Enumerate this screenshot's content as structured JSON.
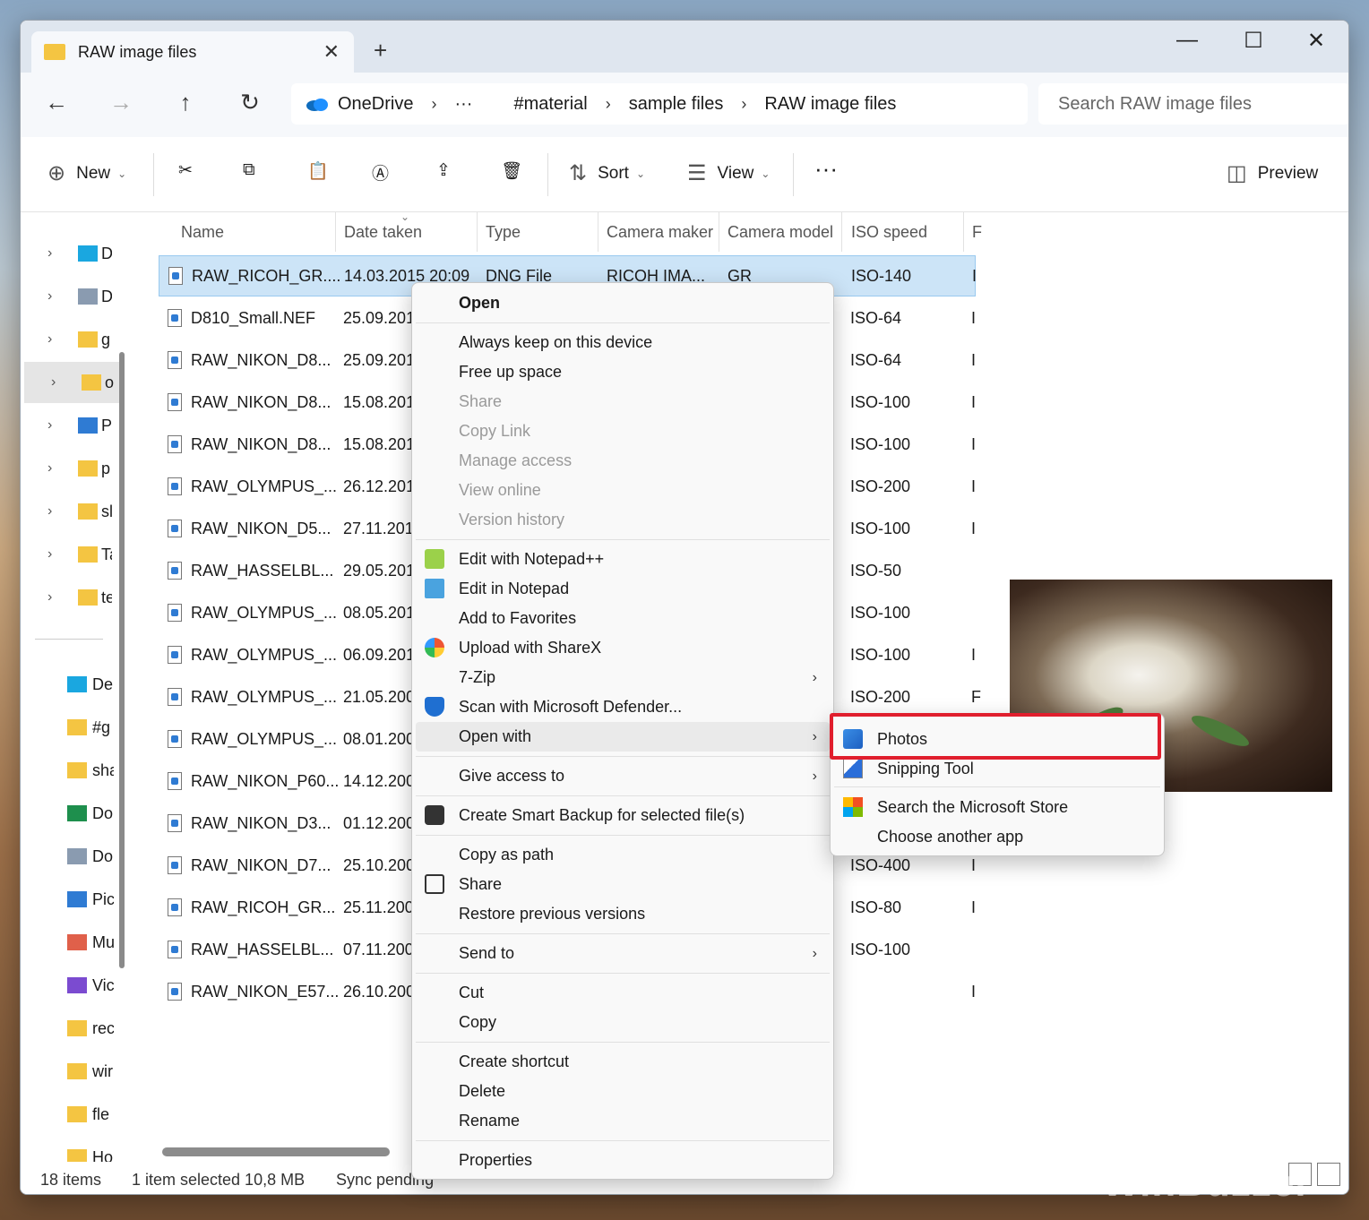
{
  "window": {
    "tab_title": "RAW image files"
  },
  "address": {
    "crumbs": [
      "OneDrive",
      "···",
      "#material",
      "sample files",
      "RAW image files"
    ],
    "search_placeholder": "Search RAW image files"
  },
  "toolbar": {
    "new_label": "New",
    "sort_label": "Sort",
    "view_label": "View",
    "preview_label": "Preview"
  },
  "nav": {
    "top": [
      {
        "l": "D",
        "icon": "desktop-icon"
      },
      {
        "l": "D",
        "icon": "document-icon"
      },
      {
        "l": "g",
        "icon": "folder-icon"
      },
      {
        "l": "o",
        "icon": "folder-icon"
      },
      {
        "l": "P",
        "icon": "pictures-icon"
      },
      {
        "l": "p",
        "icon": "folder-icon"
      },
      {
        "l": "sl",
        "icon": "folder-icon"
      },
      {
        "l": "Ta",
        "icon": "folder-icon"
      },
      {
        "l": "te",
        "icon": "folder-icon"
      }
    ],
    "bottom": [
      {
        "l": "De",
        "icon": "desktop-icon"
      },
      {
        "l": "#g",
        "icon": "folder-icon"
      },
      {
        "l": "sha",
        "icon": "folder-icon"
      },
      {
        "l": "Do",
        "icon": "download-icon"
      },
      {
        "l": "Do",
        "icon": "document-icon"
      },
      {
        "l": "Pic",
        "icon": "pictures-icon"
      },
      {
        "l": "Mu",
        "icon": "music-icon"
      },
      {
        "l": "Vic",
        "icon": "video-icon"
      },
      {
        "l": "rec",
        "icon": "folder-icon"
      },
      {
        "l": "wir",
        "icon": "folder-icon"
      },
      {
        "l": "fle",
        "icon": "folder-icon"
      },
      {
        "l": "Ho",
        "icon": "folder-icon"
      }
    ]
  },
  "columns": [
    "Name",
    "Date taken",
    "Type",
    "Camera maker",
    "Camera model",
    "ISO speed",
    "F"
  ],
  "files": [
    {
      "name": "RAW_RICOH_GR....",
      "date": "14.03.2015 20:09",
      "type": "DNG File",
      "maker": "RICOH IMA...",
      "model": "GR",
      "iso": "ISO-140",
      "f": "I"
    },
    {
      "name": "D810_Small.NEF",
      "date": "25.09.201",
      "iso": "ISO-64",
      "f": "I"
    },
    {
      "name": "RAW_NIKON_D8...",
      "date": "25.09.201",
      "iso": "ISO-64",
      "f": "I"
    },
    {
      "name": "RAW_NIKON_D8...",
      "date": "15.08.201",
      "iso": "ISO-100",
      "f": "I"
    },
    {
      "name": "RAW_NIKON_D8...",
      "date": "15.08.201",
      "iso": "ISO-100",
      "f": "I"
    },
    {
      "name": "RAW_OLYMPUS_...",
      "date": "26.12.201",
      "iso": "ISO-200",
      "f": "I"
    },
    {
      "name": "RAW_NIKON_D5...",
      "date": "27.11.201",
      "iso": "ISO-100",
      "f": "I"
    },
    {
      "name": "RAW_HASSELBL...",
      "date": "29.05.201",
      "iso": "ISO-50",
      "f": ""
    },
    {
      "name": "RAW_OLYMPUS_...",
      "date": "08.05.201",
      "iso": "ISO-100",
      "f": ""
    },
    {
      "name": "RAW_OLYMPUS_...",
      "date": "06.09.201",
      "iso": "ISO-100",
      "f": "I"
    },
    {
      "name": "RAW_OLYMPUS_...",
      "date": "21.05.200",
      "iso": "ISO-200",
      "f": "F"
    },
    {
      "name": "RAW_OLYMPUS_...",
      "date": "08.01.200",
      "iso": "",
      "f": ""
    },
    {
      "name": "RAW_NIKON_P60...",
      "date": "14.12.200",
      "iso": "",
      "f": ""
    },
    {
      "name": "RAW_NIKON_D3...",
      "date": "01.12.200",
      "iso": "",
      "f": ""
    },
    {
      "name": "RAW_NIKON_D7...",
      "date": "25.10.200",
      "iso": "ISO-400",
      "f": "I"
    },
    {
      "name": "RAW_RICOH_GR...",
      "date": "25.11.200",
      "iso": "ISO-80",
      "f": "I"
    },
    {
      "name": "RAW_HASSELBL...",
      "date": "07.11.200",
      "iso": "ISO-100",
      "f": ""
    },
    {
      "name": "RAW_NIKON_E57...",
      "date": "26.10.200",
      "iso": "",
      "f": "I"
    }
  ],
  "context_menu": [
    {
      "label": "Open",
      "bold": true
    },
    {
      "sep": true
    },
    {
      "label": "Always keep on this device"
    },
    {
      "label": "Free up space"
    },
    {
      "label": "Share",
      "disabled": true
    },
    {
      "label": "Copy Link",
      "disabled": true
    },
    {
      "label": "Manage access",
      "disabled": true
    },
    {
      "label": "View online",
      "disabled": true
    },
    {
      "label": "Version history",
      "disabled": true
    },
    {
      "sep": true
    },
    {
      "label": "Edit with Notepad++",
      "icon": "notepadpp-icon"
    },
    {
      "label": "Edit in Notepad",
      "icon": "notepad-icon"
    },
    {
      "label": "Add to Favorites"
    },
    {
      "label": "Upload with ShareX",
      "icon": "sharex-icon"
    },
    {
      "label": "7-Zip",
      "arrow": true
    },
    {
      "label": "Scan with Microsoft Defender...",
      "icon": "defender-icon"
    },
    {
      "label": "Open with",
      "arrow": true,
      "hover": true
    },
    {
      "sep": true
    },
    {
      "label": "Give access to",
      "arrow": true
    },
    {
      "sep": true
    },
    {
      "label": "Create Smart Backup for selected file(s)",
      "icon": "backup-icon"
    },
    {
      "sep": true
    },
    {
      "label": "Copy as path"
    },
    {
      "label": "Share",
      "icon": "share-icon"
    },
    {
      "label": "Restore previous versions"
    },
    {
      "sep": true
    },
    {
      "label": "Send to",
      "arrow": true
    },
    {
      "sep": true
    },
    {
      "label": "Cut"
    },
    {
      "label": "Copy"
    },
    {
      "sep": true
    },
    {
      "label": "Create shortcut"
    },
    {
      "label": "Delete"
    },
    {
      "label": "Rename"
    },
    {
      "sep": true
    },
    {
      "label": "Properties"
    }
  ],
  "submenu": [
    {
      "label": "Photos",
      "icon": "photos-icon"
    },
    {
      "label": "Snipping Tool",
      "icon": "snipping-tool-icon"
    },
    {
      "sep": true
    },
    {
      "label": "Search the Microsoft Store",
      "icon": "store-icon"
    },
    {
      "label": "Choose another app"
    }
  ],
  "status": {
    "items": "18 items",
    "selected": "1 item selected  10,8 MB",
    "sync": "Sync pending"
  },
  "watermark": "WinBuzzer",
  "colors": {
    "selection": "#cce4f7",
    "highlight_box": "#e01e2d",
    "folder": "#f4c542"
  }
}
